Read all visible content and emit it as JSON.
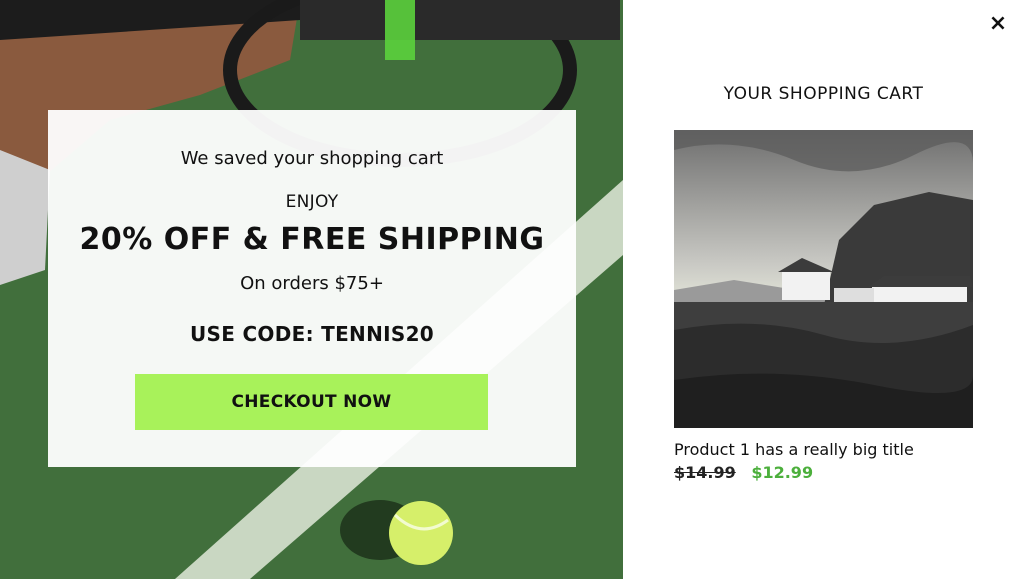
{
  "offer": {
    "saved_text": "We saved your shopping cart",
    "enjoy": "ENJOY",
    "headline": "20% OFF & FREE SHIPPING",
    "condition": "On orders $75+",
    "code_text": "USE CODE: TENNIS20",
    "checkout_label": "CHECKOUT NOW"
  },
  "cart": {
    "close_glyph": "×",
    "title": "YOUR SHOPPING CART",
    "product": {
      "title": "Product 1 has a really big title",
      "old_price": "$14.99",
      "new_price": "$12.99"
    }
  },
  "colors": {
    "accent_button": "#a8f25a",
    "sale_price": "#4caf3c",
    "court_green": "#3f6a3a"
  },
  "icons": {
    "close": "close-icon"
  }
}
